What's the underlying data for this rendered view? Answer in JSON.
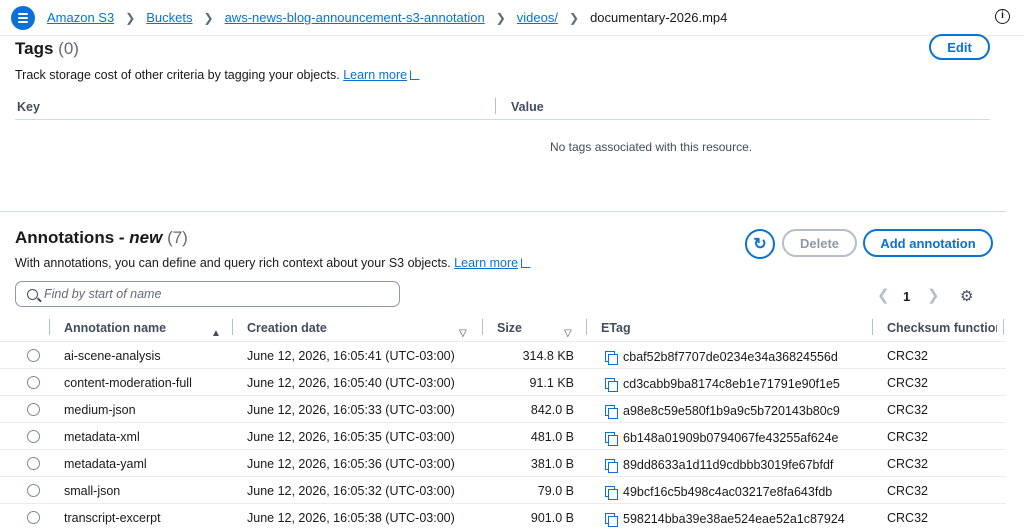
{
  "breadcrumb": {
    "items": [
      "Amazon S3",
      "Buckets",
      "aws-news-blog-announcement-s3-annotation",
      "videos/"
    ],
    "current": "documentary-2026.mp4"
  },
  "tags": {
    "title": "Tags",
    "count": "(0)",
    "edit_label": "Edit",
    "description": "Track storage cost of other criteria by tagging your objects.",
    "learn_more": "Learn more",
    "columns": [
      "Key",
      "Value"
    ],
    "empty_message": "No tags associated with this resource."
  },
  "annotations": {
    "title": "Annotations - ",
    "title_new": "new",
    "count": "(7)",
    "description": "With annotations, you can define and query rich context about your S3 objects.",
    "learn_more": "Learn more",
    "delete_label": "Delete",
    "add_label": "Add annotation",
    "search_placeholder": "Find by start of name",
    "page": "1",
    "columns": {
      "name": "Annotation name",
      "created": "Creation date",
      "size": "Size",
      "etag": "ETag",
      "checksum": "Checksum function"
    },
    "rows": [
      {
        "name": "ai-scene-analysis",
        "created": "June 12, 2026, 16:05:41 (UTC-03:00)",
        "size": "314.8 KB",
        "etag": "cbaf52b8f7707de0234e34a36824556d",
        "checksum": "CRC32"
      },
      {
        "name": "content-moderation-full",
        "created": "June 12, 2026, 16:05:40 (UTC-03:00)",
        "size": "91.1 KB",
        "etag": "cd3cabb9ba8174c8eb1e71791e90f1e5",
        "checksum": "CRC32"
      },
      {
        "name": "medium-json",
        "created": "June 12, 2026, 16:05:33 (UTC-03:00)",
        "size": "842.0 B",
        "etag": "a98e8c59e580f1b9a9c5b720143b80c9",
        "checksum": "CRC32"
      },
      {
        "name": "metadata-xml",
        "created": "June 12, 2026, 16:05:35 (UTC-03:00)",
        "size": "481.0 B",
        "etag": "6b148a01909b0794067fe43255af624e",
        "checksum": "CRC32"
      },
      {
        "name": "metadata-yaml",
        "created": "June 12, 2026, 16:05:36 (UTC-03:00)",
        "size": "381.0 B",
        "etag": "89dd8633a1d11d9cdbbb3019fe67bfdf",
        "checksum": "CRC32"
      },
      {
        "name": "small-json",
        "created": "June 12, 2026, 16:05:32 (UTC-03:00)",
        "size": "79.0 B",
        "etag": "49bcf16c5b498c4ac03217e8fa643fdb",
        "checksum": "CRC32"
      },
      {
        "name": "transcript-excerpt",
        "created": "June 12, 2026, 16:05:38 (UTC-03:00)",
        "size": "901.0 B",
        "etag": "598214bba39e38ae524eae52a1c87924",
        "checksum": "CRC32"
      }
    ]
  },
  "colors": {
    "accent": "#0972d3",
    "text": "#16191f",
    "muted": "#5f6b7a",
    "border": "#d5dbdb"
  }
}
